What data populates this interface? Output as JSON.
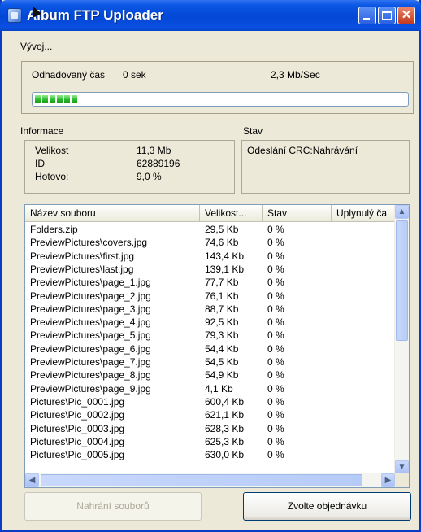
{
  "window": {
    "title": "Album FTP Uploader"
  },
  "progress_group": {
    "label": "Vývoj...",
    "estimated_time_label": "Odhadovaný čas",
    "estimated_time_value": "0 sek",
    "speed": "2,3 Mb/Sec",
    "progress_fraction": 0.12,
    "bar_color": "#2bb52b"
  },
  "info": {
    "title": "Informace",
    "rows": [
      {
        "label": "Velikost",
        "value": "11,3 Mb"
      },
      {
        "label": "ID",
        "value": "62889196"
      },
      {
        "label": "Hotovo:",
        "value": "9,0 %"
      }
    ]
  },
  "status": {
    "title": "Stav",
    "text": "Odeslání CRC:Nahrávání"
  },
  "file_list": {
    "columns": [
      "Název souboru",
      "Velikost...",
      "Stav",
      "Uplynulý ča"
    ],
    "rows": [
      [
        "Folders.zip",
        "29,5 Kb",
        "0 %"
      ],
      [
        "PreviewPictures\\covers.jpg",
        "74,6 Kb",
        "0 %"
      ],
      [
        "PreviewPictures\\first.jpg",
        "143,4 Kb",
        "0 %"
      ],
      [
        "PreviewPictures\\last.jpg",
        "139,1 Kb",
        "0 %"
      ],
      [
        "PreviewPictures\\page_1.jpg",
        "77,7 Kb",
        "0 %"
      ],
      [
        "PreviewPictures\\page_2.jpg",
        "76,1 Kb",
        "0 %"
      ],
      [
        "PreviewPictures\\page_3.jpg",
        "88,7 Kb",
        "0 %"
      ],
      [
        "PreviewPictures\\page_4.jpg",
        "92,5 Kb",
        "0 %"
      ],
      [
        "PreviewPictures\\page_5.jpg",
        "79,3 Kb",
        "0 %"
      ],
      [
        "PreviewPictures\\page_6.jpg",
        "54,4 Kb",
        "0 %"
      ],
      [
        "PreviewPictures\\page_7.jpg",
        "54,5 Kb",
        "0 %"
      ],
      [
        "PreviewPictures\\page_8.jpg",
        "54,9 Kb",
        "0 %"
      ],
      [
        "PreviewPictures\\page_9.jpg",
        "4,1 Kb",
        "0 %"
      ],
      [
        "Pictures\\Pic_0001.jpg",
        "600,4 Kb",
        "0 %"
      ],
      [
        "Pictures\\Pic_0002.jpg",
        "621,1 Kb",
        "0 %"
      ],
      [
        "Pictures\\Pic_0003.jpg",
        "628,3 Kb",
        "0 %"
      ],
      [
        "Pictures\\Pic_0004.jpg",
        "625,3 Kb",
        "0 %"
      ],
      [
        "Pictures\\Pic_0005.jpg",
        "630,0 Kb",
        "0 %"
      ]
    ]
  },
  "buttons": {
    "upload": "Nahrání souborů",
    "order": "Zvolte objednávku"
  },
  "icons": {
    "app": "album-icon",
    "minimize": "minimize-icon",
    "maximize": "maximize-icon",
    "close": "close-icon",
    "scroll_up": "arrow-up-icon",
    "scroll_down": "arrow-down-icon",
    "scroll_left": "arrow-left-icon",
    "scroll_right": "arrow-right-icon"
  }
}
